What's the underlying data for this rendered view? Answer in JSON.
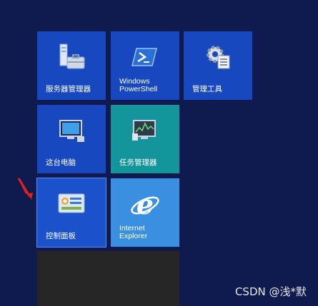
{
  "tiles": {
    "server_manager": {
      "label": "服务器管理器",
      "icon": "server-manager-icon"
    },
    "powershell": {
      "label": "Windows\nPowerShell",
      "icon": "powershell-icon"
    },
    "admin_tools": {
      "label": "管理工具",
      "icon": "admin-tools-icon"
    },
    "this_pc": {
      "label": "这台电脑",
      "icon": "this-pc-icon"
    },
    "task_manager": {
      "label": "任务管理器",
      "icon": "task-manager-icon"
    },
    "control_panel": {
      "label": "控制面板",
      "icon": "control-panel-icon"
    },
    "ie": {
      "label": "Internet\nExplorer",
      "icon": "internet-explorer-icon"
    }
  },
  "watermark": "CSDN @浅*默",
  "colors": {
    "background": "#0f1a4f",
    "tile_blue": "#1748c0",
    "tile_teal": "#14949b",
    "tile_ie": "#3b8fe0",
    "tile_dark": "#262626",
    "arrow": "#e02020"
  }
}
